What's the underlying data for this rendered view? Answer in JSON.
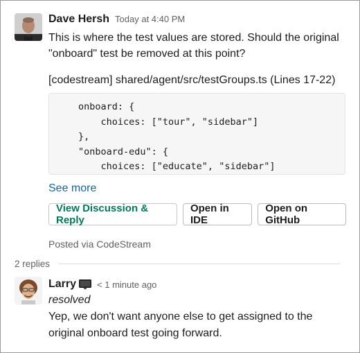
{
  "message": {
    "author": "Dave Hersh",
    "timestamp": "Today at 4:40 PM",
    "text": "This is where the test values are stored. Should the original \"onboard\" test be removed at this point?",
    "file_reference": "[codestream] shared/agent/src/testGroups.ts (Lines 17-22)",
    "code_lines": [
      "onboard: {",
      "    choices: [\"tour\", \"sidebar\"]",
      "},",
      "\"onboard-edu\": {",
      "    choices: [\"educate\", \"sidebar\"]"
    ],
    "see_more": "See more",
    "buttons": {
      "view_discussion": "View Discussion & Reply",
      "open_ide": "Open in IDE",
      "open_github": "Open on GitHub"
    },
    "posted_via": "Posted via CodeStream"
  },
  "thread": {
    "replies_label": "2 replies"
  },
  "reply": {
    "author": "Larry",
    "timestamp": "< 1 minute ago",
    "status": "resolved",
    "text": "Yep, we don't want anyone else to get assigned to the original onboard test going forward."
  },
  "colors": {
    "link": "#1264a3",
    "primary_button": "#007a5a",
    "muted_text": "#616061"
  },
  "icons": {
    "status_icon": "monitor-icon"
  }
}
